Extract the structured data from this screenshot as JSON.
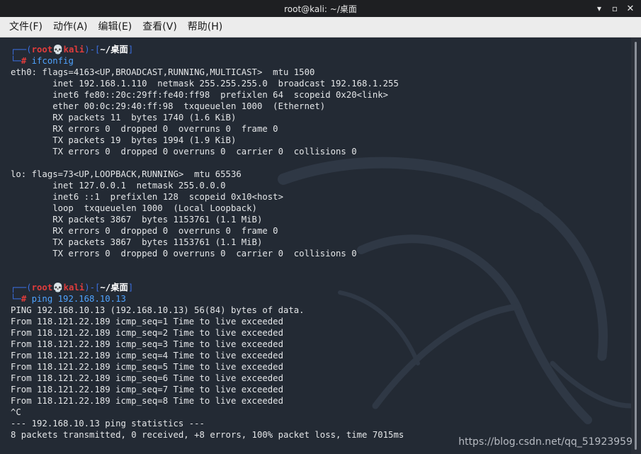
{
  "window": {
    "title": "root@kali: ~/桌面",
    "controls": {
      "minimize": "▾",
      "maximize": "▫",
      "close": "✕"
    }
  },
  "menu": [
    "文件(F)",
    "动作(A)",
    "编辑(E)",
    "查看(V)",
    "帮助(H)"
  ],
  "prompt": {
    "box_open": "┌──(",
    "user": "root",
    "skull": "💀",
    "host": "kali",
    "sep": ")-[",
    "path": "~/桌面",
    "box_close": "]",
    "corner": "└─",
    "symbol": "#"
  },
  "commands": [
    "ifconfig",
    "ping 192.168.10.13"
  ],
  "ifconfig_output": [
    "eth0: flags=4163<UP,BROADCAST,RUNNING,MULTICAST>  mtu 1500",
    "        inet 192.168.1.110  netmask 255.255.255.0  broadcast 192.168.1.255",
    "        inet6 fe80::20c:29ff:fe40:ff98  prefixlen 64  scopeid 0x20<link>",
    "        ether 00:0c:29:40:ff:98  txqueuelen 1000  (Ethernet)",
    "        RX packets 11  bytes 1740 (1.6 KiB)",
    "        RX errors 0  dropped 0  overruns 0  frame 0",
    "        TX packets 19  bytes 1994 (1.9 KiB)",
    "        TX errors 0  dropped 0 overruns 0  carrier 0  collisions 0",
    "",
    "lo: flags=73<UP,LOOPBACK,RUNNING>  mtu 65536",
    "        inet 127.0.0.1  netmask 255.0.0.0",
    "        inet6 ::1  prefixlen 128  scopeid 0x10<host>",
    "        loop  txqueuelen 1000  (Local Loopback)",
    "        RX packets 3867  bytes 1153761 (1.1 MiB)",
    "        RX errors 0  dropped 0  overruns 0  frame 0",
    "        TX packets 3867  bytes 1153761 (1.1 MiB)",
    "        TX errors 0  dropped 0 overruns 0  carrier 0  collisions 0",
    "",
    ""
  ],
  "ping_output": [
    "PING 192.168.10.13 (192.168.10.13) 56(84) bytes of data.",
    "From 118.121.22.189 icmp_seq=1 Time to live exceeded",
    "From 118.121.22.189 icmp_seq=2 Time to live exceeded",
    "From 118.121.22.189 icmp_seq=3 Time to live exceeded",
    "From 118.121.22.189 icmp_seq=4 Time to live exceeded",
    "From 118.121.22.189 icmp_seq=5 Time to live exceeded",
    "From 118.121.22.189 icmp_seq=6 Time to live exceeded",
    "From 118.121.22.189 icmp_seq=7 Time to live exceeded",
    "From 118.121.22.189 icmp_seq=8 Time to live exceeded",
    "^C",
    "--- 192.168.10.13 ping statistics ---",
    "8 packets transmitted, 0 received, +8 errors, 100% packet loss, time 7015ms"
  ],
  "watermark": "https://blog.csdn.net/qq_51923959",
  "colors": {
    "terminal_bg": "#232a34",
    "prompt_box": "#3b6fe0",
    "prompt_user": "#e03c3c",
    "command": "#4fa3ff",
    "text": "#e4e6e8"
  },
  "icons": [
    "skull-icon",
    "minimize-icon",
    "maximize-icon",
    "close-icon",
    "kali-dragon-icon"
  ]
}
